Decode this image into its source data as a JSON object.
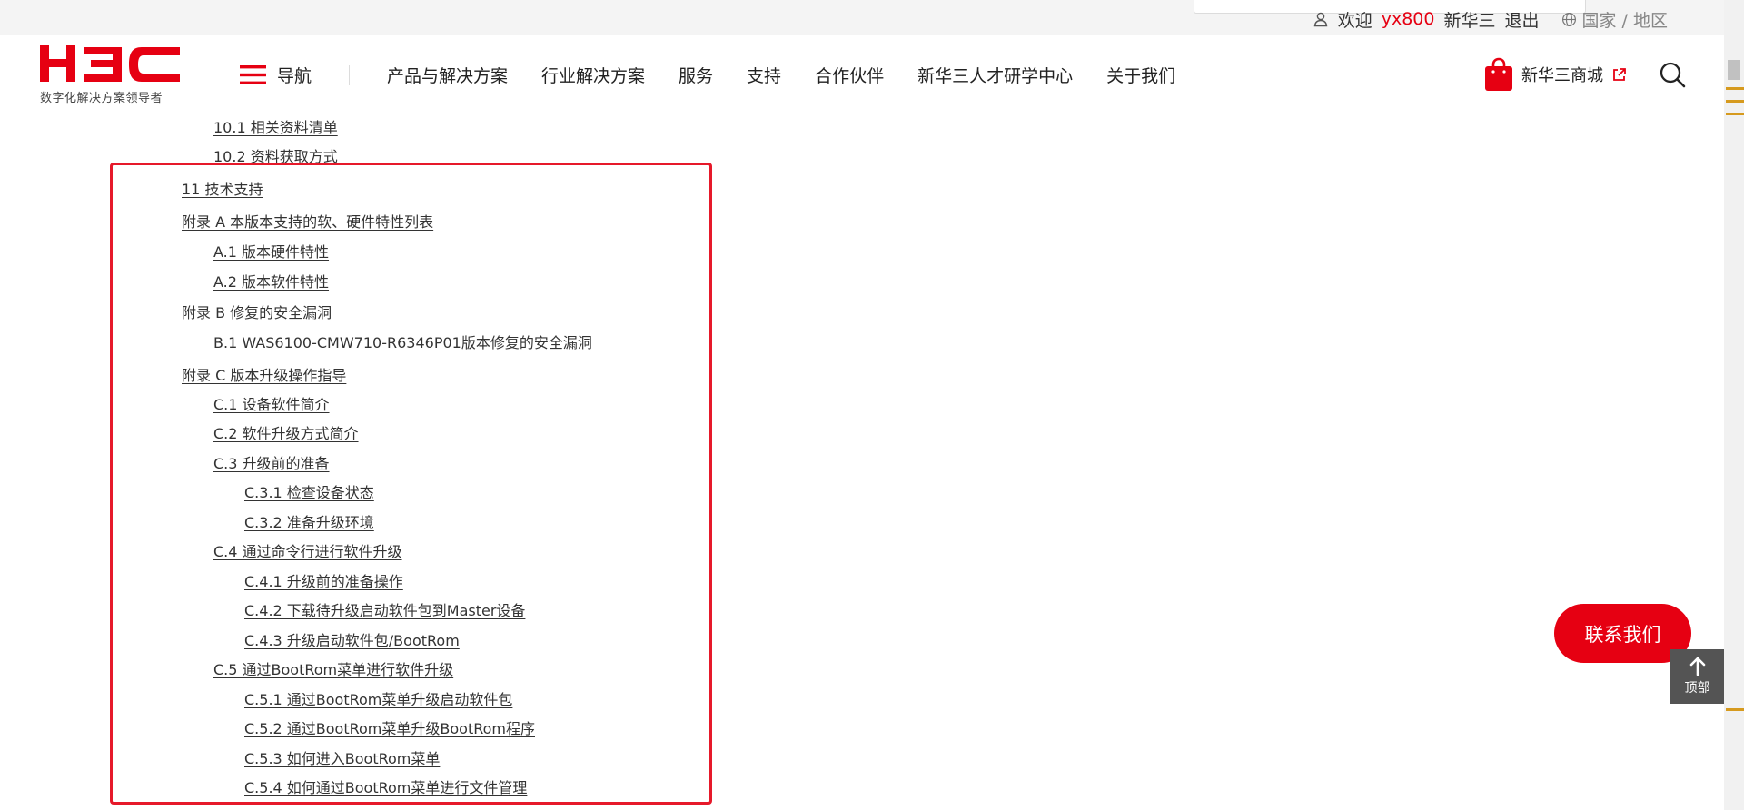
{
  "utility": {
    "welcome": "欢迎",
    "username": "yx800",
    "brand": "新华三",
    "logout": "退出",
    "region": "国家 / 地区"
  },
  "header": {
    "logo_text": "H3C",
    "logo_tagline": "数字化解决方案领导者",
    "nav_label": "导航",
    "nav_items": [
      "产品与解决方案",
      "行业解决方案",
      "服务",
      "支持",
      "合作伙伴",
      "新华三人才研学中心",
      "关于我们"
    ],
    "mall_label": "新华三商城"
  },
  "toc": [
    {
      "label": "10.1  相关资料清单",
      "level": 2
    },
    {
      "label": "10.2  资料获取方式",
      "level": 2
    },
    {
      "label": "11  技术支持",
      "level": 1
    },
    {
      "label": "附录 A  本版本支持的软、硬件特性列表",
      "level": 1
    },
    {
      "label": "A.1  版本硬件特性",
      "level": 2
    },
    {
      "label": "A.2  版本软件特性",
      "level": 2
    },
    {
      "label": "附录 B  修复的安全漏洞",
      "level": 1
    },
    {
      "label": "B.1 WAS6100-CMW710-R6346P01版本修复的安全漏洞",
      "level": 2
    },
    {
      "label": "附录 C  版本升级操作指导",
      "level": 1
    },
    {
      "label": "C.1  设备软件简介",
      "level": 2
    },
    {
      "label": "C.2  软件升级方式简介",
      "level": 2
    },
    {
      "label": "C.3  升级前的准备",
      "level": 2
    },
    {
      "label": "C.3.1  检查设备状态",
      "level": 3
    },
    {
      "label": "C.3.2  准备升级环境",
      "level": 3
    },
    {
      "label": "C.4  通过命令行进行软件升级",
      "level": 2
    },
    {
      "label": "C.4.1  升级前的准备操作",
      "level": 3
    },
    {
      "label": "C.4.2  下载待升级启动软件包到Master设备",
      "level": 3
    },
    {
      "label": "C.4.3  升级启动软件包/BootRom",
      "level": 3
    },
    {
      "label": "C.5  通过BootRom菜单进行软件升级",
      "level": 2
    },
    {
      "label": "C.5.1  通过BootRom菜单升级启动软件包",
      "level": 3
    },
    {
      "label": "C.5.2  通过BootRom菜单升级BootRom程序",
      "level": 3
    },
    {
      "label": "C.5.3  如何进入BootRom菜单",
      "level": 3
    },
    {
      "label": "C.5.4  如何通过BootRom菜单进行文件管理",
      "level": 3
    }
  ],
  "floating": {
    "contact_label": "联系我们",
    "top_label": "顶部"
  },
  "colors": {
    "brand_red": "#e60012",
    "highlight_border": "#e6192a",
    "top_button_bg": "#545454"
  }
}
